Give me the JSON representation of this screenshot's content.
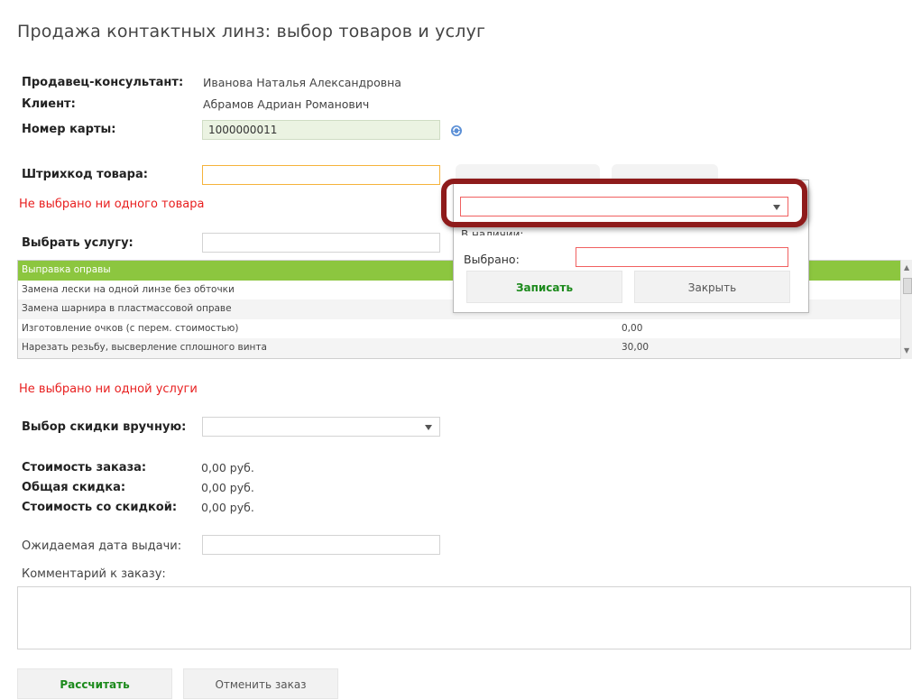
{
  "page": {
    "title": "Продажа контактных линз: выбор товаров и услуг"
  },
  "seller": {
    "label": "Продавец-консультант:",
    "value": "Иванова Наталья Александровна"
  },
  "client": {
    "label": "Клиент:",
    "value": "Абрамов Адриан Романович"
  },
  "card": {
    "label": "Номер карты:",
    "value": "1000000011",
    "refresh_icon": "refresh-icon"
  },
  "barcode": {
    "label": "Штрихкод товара:",
    "value": ""
  },
  "errors": {
    "no_goods": "Не выбрано ни одного товара",
    "no_services": "Не выбрано ни одной услуги"
  },
  "service_select": {
    "label": "Выбрать услугу:",
    "value": ""
  },
  "services": [
    {
      "name": "Выправка оправы",
      "price": ""
    },
    {
      "name": "Замена лески на одной линзе без обточки",
      "price": ""
    },
    {
      "name": "Замена шарнира в пластмассовой оправе",
      "price": ""
    },
    {
      "name": "Изготовление очков (с перем. стоимостью)",
      "price": "0,00"
    },
    {
      "name": "Нарезать резьбу, высверление сплошного винта",
      "price": "30,00"
    }
  ],
  "discount": {
    "label": "Выбор скидки вручную:",
    "value": ""
  },
  "totals": {
    "order_cost_label": "Стоимость заказа:",
    "order_cost": "0,00 руб.",
    "total_discount_label": "Общая скидка:",
    "total_discount": "0,00 руб.",
    "discounted_cost_label": "Стоимость со скидкой:",
    "discounted_cost": "0,00 руб."
  },
  "expected_date": {
    "label": "Ожидаемая дата выдачи:",
    "value": ""
  },
  "comment": {
    "label": "Комментарий к заказу:",
    "value": ""
  },
  "popup": {
    "select_value": "",
    "partial_text": "В наличии:",
    "selected_label": "Выбрано:",
    "selected_value": "",
    "save_label": "Записать",
    "close_label": "Закрыть"
  },
  "buttons": {
    "calculate": "Рассчитать",
    "cancel_order": "Отменить заказ"
  },
  "colors": {
    "accent_green": "#8cc63f",
    "error_red": "#e81f1f",
    "highlight": "#8e1b1b"
  }
}
